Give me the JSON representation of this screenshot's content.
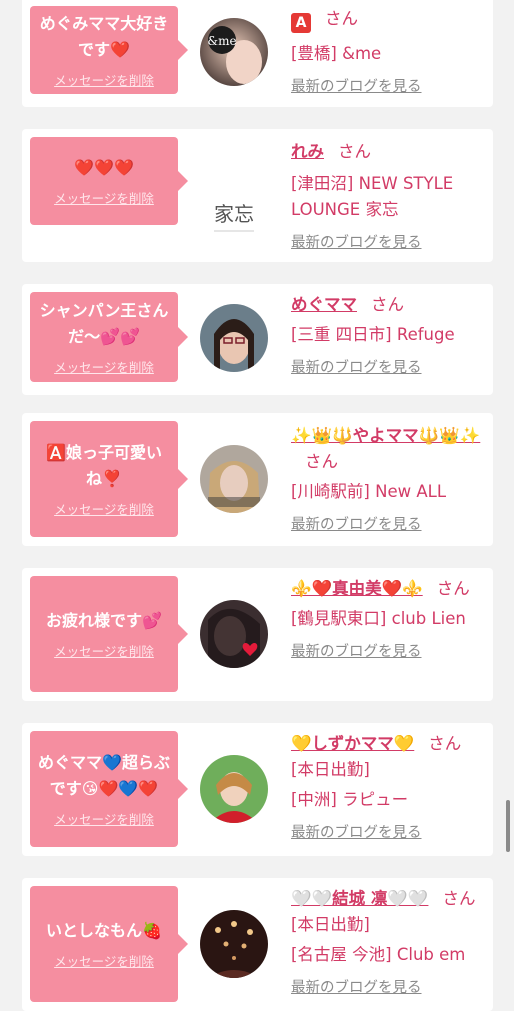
{
  "common": {
    "delete_label": "メッセージを削除",
    "blog_label": "最新のブログを見る",
    "san": "さん"
  },
  "cards": [
    {
      "message": "めぐみママ大好きです❤️",
      "name": "",
      "name_icon": "🅰️",
      "shop": "[豊橋] &me",
      "avatar": "avatar-andme"
    },
    {
      "message": "❤️❤️❤️",
      "name": "れみ",
      "shop": "[津田沼] NEW STYLE LOUNGE 家忘",
      "avatar": "avatar-kabou-logo",
      "logo_text": "家忘"
    },
    {
      "message": "シャンパン王さんだ〜💕💕",
      "name": "めぐママ",
      "shop": "[三重 四日市] Refuge",
      "avatar": "avatar-glasses-woman"
    },
    {
      "message": "🅰️娘っ子可愛いね❣️",
      "name": "✨👑🔱やよママ🔱👑✨",
      "shop": "[川崎駅前] New ALL",
      "avatar": "avatar-blonde-woman"
    },
    {
      "message": "お疲れ様です💕",
      "name": "⚜️❤️真由美❤️⚜️",
      "shop": "[鶴見駅東口] club Lien",
      "avatar": "avatar-dark-woman"
    },
    {
      "message": "めぐママ💙超らぶです😘❤️💙❤️",
      "name": "💛しずかママ💛",
      "status": "[本日出勤]",
      "shop": "[中洲] ラピュー",
      "avatar": "avatar-red-dress"
    },
    {
      "message": "いとしなもん🍓",
      "name": "🤍🤍結城 凛🤍🤍",
      "status": "[本日出勤]",
      "shop": "[名古屋 今池] Club em",
      "avatar": "avatar-chandelier"
    }
  ]
}
